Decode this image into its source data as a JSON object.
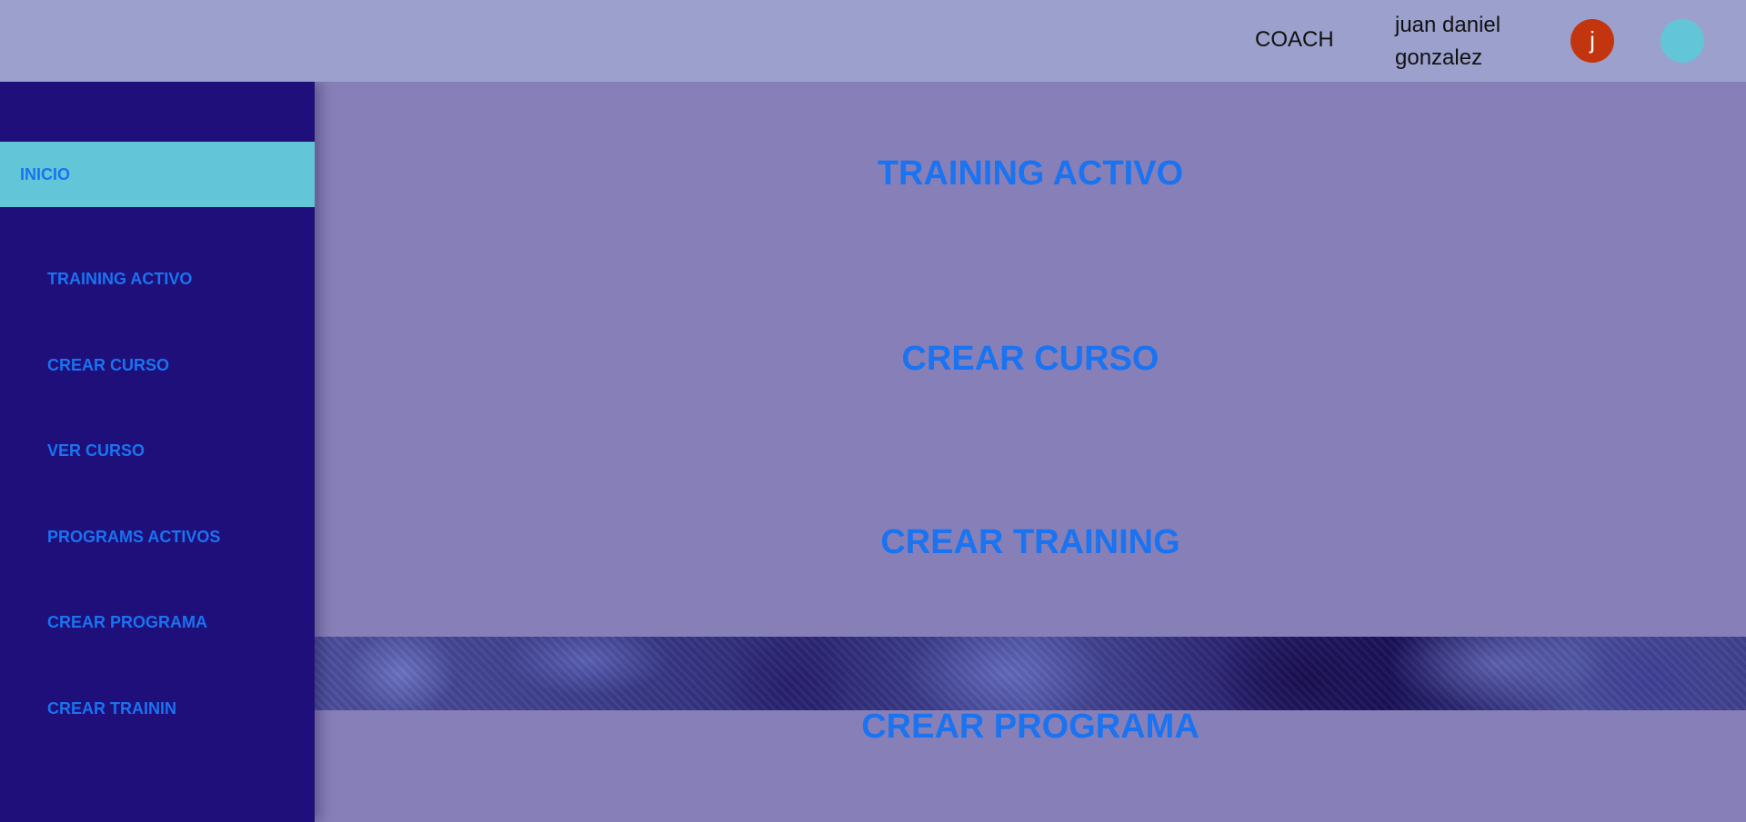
{
  "header": {
    "role": "COACH",
    "user_name": "juan daniel gonzalez",
    "avatar_initial": "j"
  },
  "sidebar": {
    "home": "INICIO",
    "items": [
      {
        "label": "TRAINING ACTIVO"
      },
      {
        "label": "CREAR CURSO"
      },
      {
        "label": "VER CURSO"
      },
      {
        "label": "PROGRAMS ACTIVOS"
      },
      {
        "label": "CREAR PROGRAMA"
      },
      {
        "label": "CREAR TRAININ"
      }
    ]
  },
  "main": {
    "sections": [
      {
        "title": "TRAINING ACTIVO"
      },
      {
        "title": "CREAR CURSO"
      },
      {
        "title": "CREAR TRAINING"
      },
      {
        "title": "CREAR PROGRAMA"
      }
    ]
  },
  "colors": {
    "header_bg": "#9ba0cc",
    "sidebar_bg": "#1e0f7b",
    "active_item_bg": "#62c6d8",
    "content_bg": "#8780b8",
    "link_text": "#1a73f0",
    "avatar_bg": "#c2350f",
    "status_dot": "#62c6d8"
  }
}
